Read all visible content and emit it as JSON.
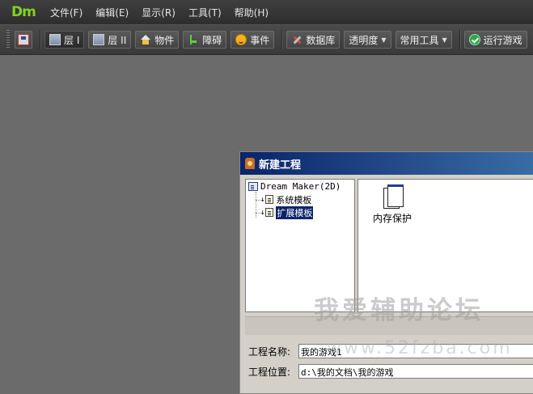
{
  "app": {
    "logo": "Dm"
  },
  "menu": [
    {
      "label": "文件(F)"
    },
    {
      "label": "编辑(E)"
    },
    {
      "label": "显示(R)"
    },
    {
      "label": "工具(T)"
    },
    {
      "label": "帮助(H)"
    }
  ],
  "toolbar": {
    "layer1": "层 I",
    "layer2": "层 II",
    "objects": "物件",
    "obstacles": "障碍",
    "events": "事件",
    "database": "数据库",
    "opacity": "透明度",
    "common_tools": "常用工具",
    "run_game": "运行游戏"
  },
  "dialog": {
    "title": "新建工程",
    "tree": {
      "root": "Dream Maker(2D)",
      "children": [
        {
          "label": "系统模板"
        },
        {
          "label": "扩展模板"
        }
      ]
    },
    "templates": [
      {
        "label": "内存保护"
      }
    ],
    "project_name_label": "工程名称:",
    "project_name_value": "我的游戏1",
    "project_path_label": "工程位置:",
    "project_path_value": "d:\\我的文档\\我的游戏"
  },
  "watermark": {
    "main": "我爱辅助论坛",
    "url": "www.52fzba.com"
  }
}
